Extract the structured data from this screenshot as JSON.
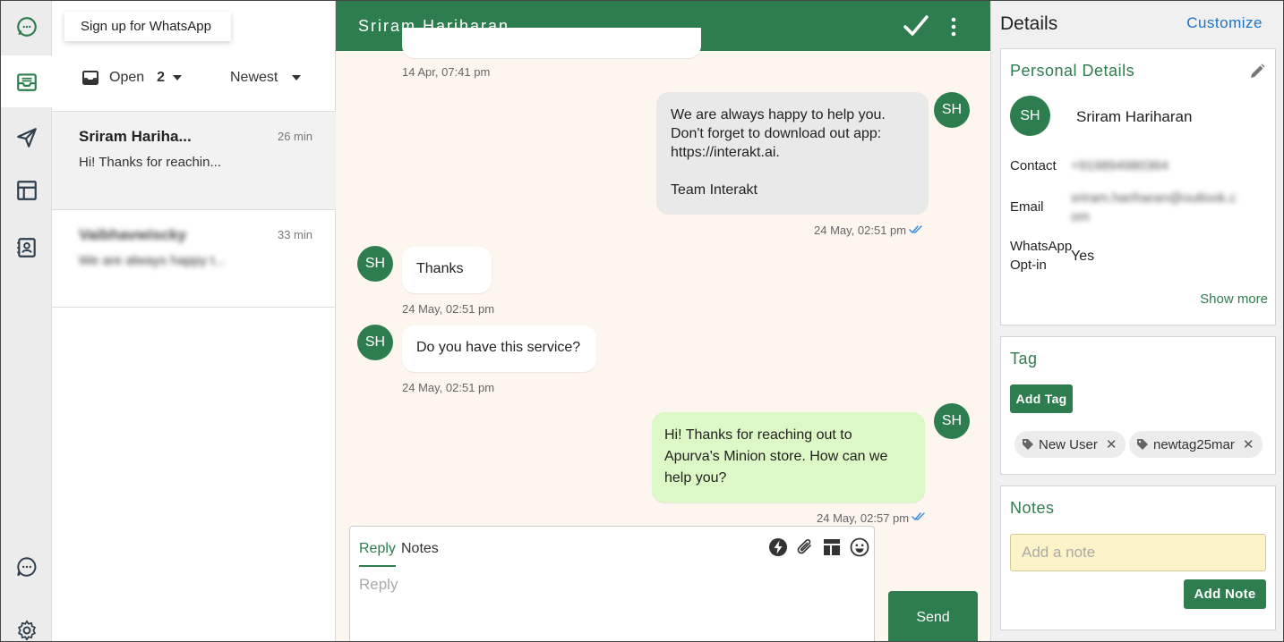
{
  "signup_banner": "Sign up for WhatsApp",
  "filters": {
    "status_label": "Open",
    "status_count": "2",
    "sort_label": "Newest"
  },
  "conversations": [
    {
      "name": "Sriram Hariha...",
      "time": "26 min",
      "preview": "Hi! Thanks for reachin..."
    },
    {
      "name": "Vaibhavwiscky",
      "time": "33 min",
      "preview": "We are always happy t..."
    }
  ],
  "chat": {
    "title": "Sriram Hariharan",
    "messages": [
      {
        "stamp": "14 Apr, 07:41 pm"
      },
      {
        "avatar": "SH",
        "text": "We are always happy to help you.\nDon't forget to download out app:\nhttps://interakt.ai.\n\nTeam Interakt",
        "stamp": "24 May, 02:51 pm"
      },
      {
        "avatar": "SH",
        "text": "Thanks",
        "stamp": "24 May, 02:51 pm"
      },
      {
        "avatar": "SH",
        "text": "Do you have this service?",
        "stamp": "24 May, 02:51 pm"
      },
      {
        "avatar": "SH",
        "text": "Hi! Thanks for reaching out to\nApurva's Minion store. How can we\nhelp you?",
        "stamp": "24 May, 02:57 pm"
      }
    ],
    "composer": {
      "tab_reply": "Reply",
      "tab_notes": "Notes",
      "placeholder": "Reply",
      "send_label": "Send"
    }
  },
  "details": {
    "title": "Details",
    "customize_label": "Customize",
    "personal": {
      "title": "Personal Details",
      "avatar": "SH",
      "name": "Sriram Hariharan",
      "contact_label": "Contact",
      "contact_value": "+919894980364",
      "email_label": "Email",
      "email_value": "sriram.hariharan@outlook.com",
      "optin_label": "WhatsApp\nOpt-in",
      "optin_value": "Yes",
      "show_more": "Show more"
    },
    "tag": {
      "title": "Tag",
      "add_label": "Add Tag",
      "tags": [
        "New User",
        "newtag25mar"
      ]
    },
    "notes": {
      "title": "Notes",
      "placeholder": "Add a note",
      "add_label": "Add Note"
    }
  },
  "colors": {
    "brand_green": "#2e7d4f",
    "outgoing_bubble": "#dcf8c6",
    "chat_background": "#fcf6ef",
    "link_blue": "#1a73c9",
    "note_yellow": "#fdf3c8"
  }
}
